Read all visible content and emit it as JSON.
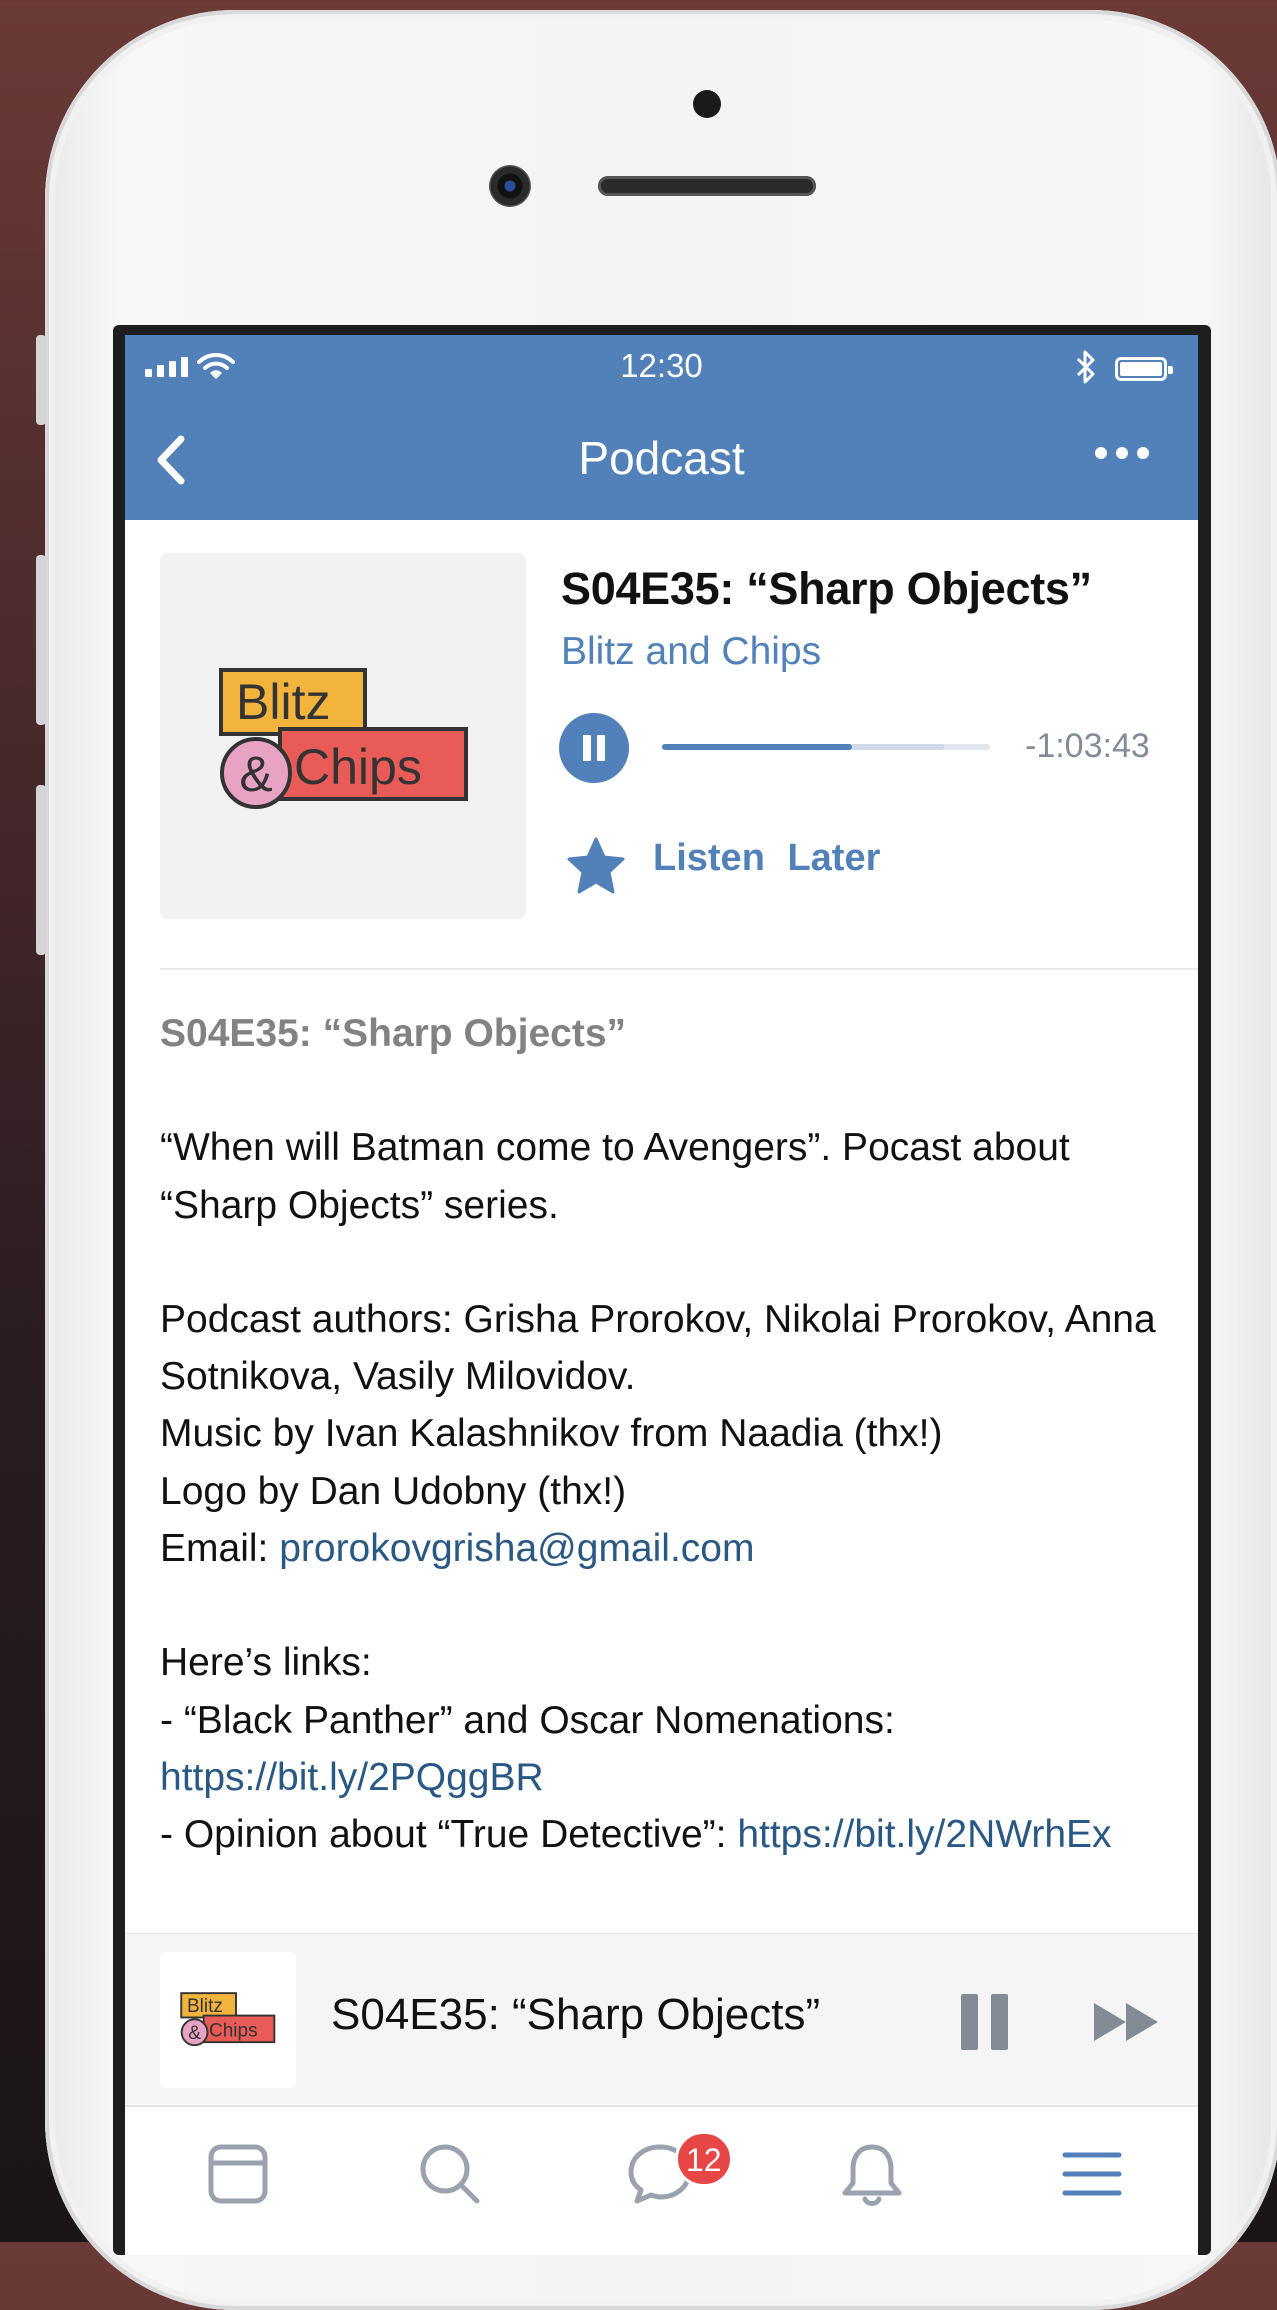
{
  "status_bar": {
    "time": "12:30"
  },
  "nav": {
    "title": "Podcast"
  },
  "episode": {
    "title": "S04E35: “Sharp Objects”",
    "podcast_name": "Blitz and Chips",
    "time_remaining": "-1:03:43",
    "progress_fraction": 0.58,
    "buffered_fraction": 0.86,
    "listen_later_label": "Listen  Later",
    "cover_logo": {
      "line1": "Blitz",
      "ampersand": "&",
      "line2": "Chips"
    }
  },
  "description": {
    "heading": "S04E35: “Sharp Objects”",
    "paragraph1": "“When will Batman come to Avengers”. Pocast about “Sharp Objects” series.",
    "authors": "Podcast authors: Grisha Prorokov, Nikolai Prorokov, Anna Sotnikova, Vasily Milovidov.",
    "music": "Music by Ivan Kalashnikov from Naadia (thx!)",
    "logo": "Logo by Dan Udobny (thx!)",
    "email_label": "Email: ",
    "email": "prorokovgrisha@gmail.com",
    "links_intro": "Here’s links:",
    "link1_text": "- “Black Panther” and Oscar Nomenations: ",
    "link1_url": "https://bit.ly/2PQggBR",
    "link2_text": "- Opinion about “True Detective”: ",
    "link2_url": "https://bit.ly/2NWrhEx"
  },
  "mini_player": {
    "title": "S04E35: “Sharp Objects”"
  },
  "tab_bar": {
    "messages_badge": "12"
  },
  "colors": {
    "accent": "#5181b8",
    "link": "#2a5885",
    "badge": "#e64646",
    "logo_yellow": "#f3b43e",
    "logo_red": "#e85b57",
    "logo_pink": "#e8a3c4"
  }
}
